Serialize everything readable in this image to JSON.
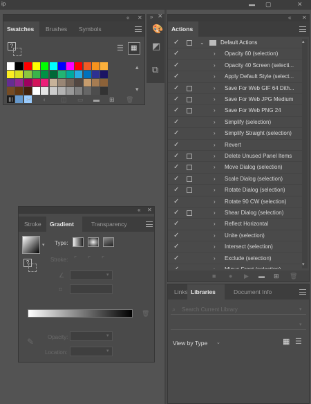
{
  "app": {
    "title_fragment": "ip"
  },
  "swatches_panel": {
    "tabs": [
      "Swatches",
      "Brushes",
      "Symbols"
    ],
    "colors": [
      [
        "#ffffff",
        "#000000",
        "#ff0000",
        "#ffff00",
        "#00ff00",
        "#00ffff",
        "#0000ff",
        "#ff00ff",
        "#ff0000",
        "#f15a24",
        "#f7931e",
        "#fbb03b"
      ],
      [
        "#fcee21",
        "#d9e021",
        "#8cc63f",
        "#39b54a",
        "#009245",
        "#006837",
        "#22b573",
        "#00a99d",
        "#29abe2",
        "#0071bc",
        "#2e3192",
        "#1b1464"
      ],
      [
        "#662d91",
        "#93278f",
        "#9e005d",
        "#d4145a",
        "#ed1e79",
        "#c7b299",
        "#998675",
        "#736357",
        "#534741",
        "#c69c6d",
        "#a67c52",
        "#8c6239"
      ],
      [
        "#754c24",
        "#603813",
        "#42210b",
        "#ffffff",
        "#e6e6e6",
        "#cccccc",
        "#b3b3b3",
        "#999999",
        "#808080",
        "#666666",
        "#4d4d4d",
        "#333333"
      ],
      [
        "#1a1a1a",
        "#6699cc",
        "#99ccff"
      ]
    ]
  },
  "gradient_panel": {
    "tabs": [
      "Stroke",
      "Gradient",
      "Transparency"
    ],
    "type_label": "Type:",
    "stroke_label": "Stroke:",
    "opacity_label": "Opacity:",
    "location_label": "Location:"
  },
  "actions_panel": {
    "title": "Actions",
    "set_name": "Default Actions",
    "items": [
      {
        "label": "Opacity 60 (selection)",
        "dialog": false
      },
      {
        "label": "Opacity 40 Screen (selecti...",
        "dialog": false
      },
      {
        "label": "Apply Default Style (select...",
        "dialog": false
      },
      {
        "label": "Save For Web GIF 64 Dith...",
        "dialog": true
      },
      {
        "label": "Save For Web JPG Medium",
        "dialog": true
      },
      {
        "label": "Save For Web PNG 24",
        "dialog": true
      },
      {
        "label": "Simplify (selection)",
        "dialog": false
      },
      {
        "label": "Simplify Straight (selection)",
        "dialog": false
      },
      {
        "label": "Revert",
        "dialog": false
      },
      {
        "label": "Delete Unused Panel Items",
        "dialog": true
      },
      {
        "label": "Move Dialog (selection)",
        "dialog": true
      },
      {
        "label": "Scale Dialog (selection)",
        "dialog": true
      },
      {
        "label": "Rotate Dialog (selection)",
        "dialog": true
      },
      {
        "label": "Rotate 90 CW (selection)",
        "dialog": false
      },
      {
        "label": "Shear Dialog (selection)",
        "dialog": true
      },
      {
        "label": "Reflect Horizontal",
        "dialog": false
      },
      {
        "label": "Unite (selection)",
        "dialog": false
      },
      {
        "label": "Intersect (selection)",
        "dialog": false
      },
      {
        "label": "Exclude (selection)",
        "dialog": false
      },
      {
        "label": "Minus Front (selection)",
        "dialog": false
      }
    ]
  },
  "libraries_panel": {
    "tabs": [
      "Links",
      "Libraries",
      "Document Info"
    ],
    "search_placeholder": "Search Current Library",
    "view_by": "View by Type"
  }
}
